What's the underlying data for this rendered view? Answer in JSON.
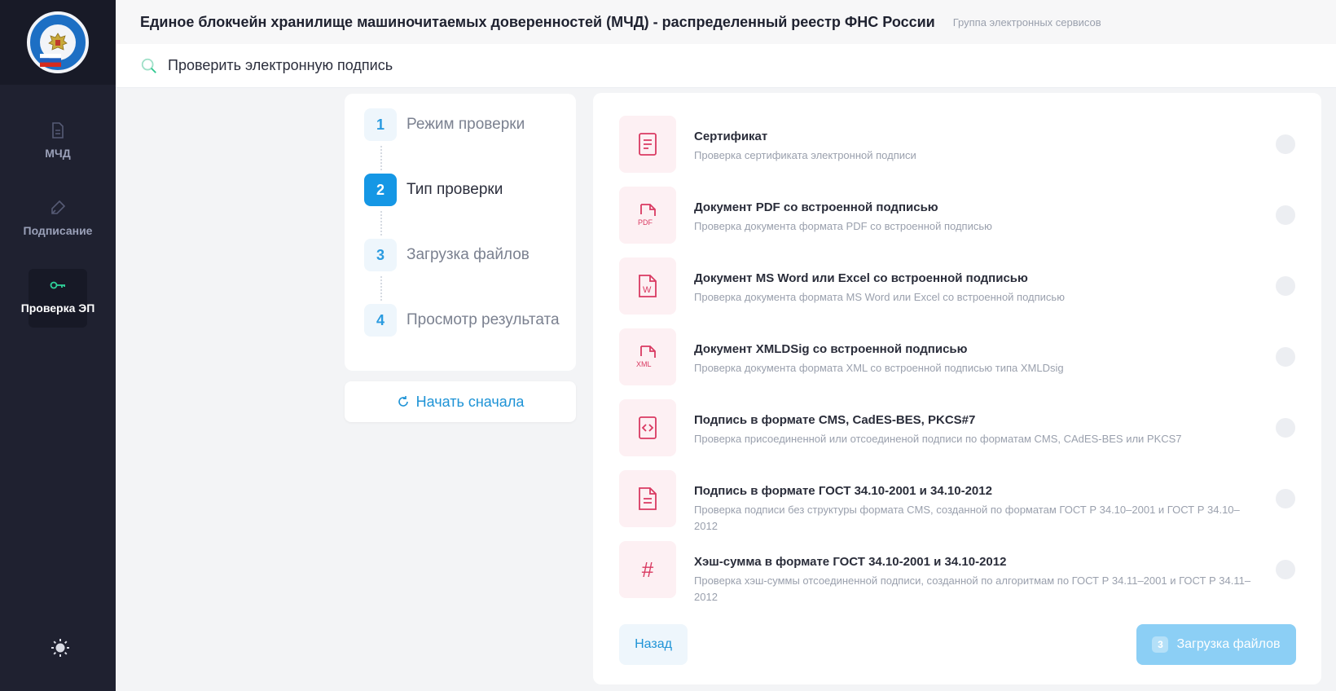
{
  "header": {
    "title": "Единое блокчейн хранилище машиночитаемых доверенностей (МЧД) - распределенный реестр ФНС России",
    "subtitle": "Группа электронных сервисов"
  },
  "subheader": {
    "title": "Проверить электронную подпись",
    "icon": "search-check-icon"
  },
  "sidebar": {
    "items": [
      {
        "label": "МЧД",
        "icon": "document-icon"
      },
      {
        "label": "Подписание",
        "icon": "pen-icon"
      },
      {
        "label": "Проверка ЭП",
        "icon": "key-icon"
      }
    ],
    "theme_icon": "sun-icon"
  },
  "stepper": {
    "steps": [
      {
        "num": "1",
        "label": "Режим проверки"
      },
      {
        "num": "2",
        "label": "Тип проверки"
      },
      {
        "num": "3",
        "label": "Загрузка файлов"
      },
      {
        "num": "4",
        "label": "Просмотр результата"
      }
    ],
    "active_step": 2,
    "restart_label": "Начать сначала"
  },
  "options": [
    {
      "title": "Сертификат",
      "desc": "Проверка сертификата электронной подписи",
      "icon": "document-lines-icon"
    },
    {
      "title": "Документ PDF со встроенной подписью",
      "desc": "Проверка документа формата PDF со встроенной подписью",
      "icon": "pdf-file-icon",
      "file_tag": "PDF"
    },
    {
      "title": "Документ MS Word или Excel со встроенной подписью",
      "desc": "Проверка документа формата MS Word или Excel со встроенной подписью",
      "icon": "word-file-icon",
      "file_tag": "W"
    },
    {
      "title": "Документ XMLDSig со встроенной подписью",
      "desc": "Проверка документа формата XML со встроенной подписью типа XMLDsig",
      "icon": "xml-file-icon",
      "file_tag": "XML"
    },
    {
      "title": "Подпись в формате CMS, CadES-BES, PKCS#7",
      "desc": "Проверка присоединенной или отсоединеной подписи по форматам CMS, CAdES-BES или PKCS7",
      "icon": "code-file-icon"
    },
    {
      "title": "Подпись в формате ГОСТ 34.10-2001 и 34.10-2012",
      "desc": "Проверка подписи без структуры формата CMS, созданной по форматам ГОСТ Р 34.10–2001 и ГОСТ Р 34.10–2012",
      "icon": "document-lines-icon"
    },
    {
      "title": "Хэш-сумма в формате ГОСТ 34.10-2001 и 34.10-2012",
      "desc": "Проверка хэш-суммы отсоединенной подписи, созданной по алгоритмам по ГОСТ Р 34.11–2001 и ГОСТ Р 34.11–2012",
      "icon": "hash-icon",
      "glyph": "#"
    }
  ],
  "footer": {
    "back_label": "Назад",
    "next_badge": "3",
    "next_label": "Загрузка файлов"
  },
  "colors": {
    "accent": "#1597e5",
    "icon_red": "#d93a62",
    "sidebar": "#1f2130"
  }
}
